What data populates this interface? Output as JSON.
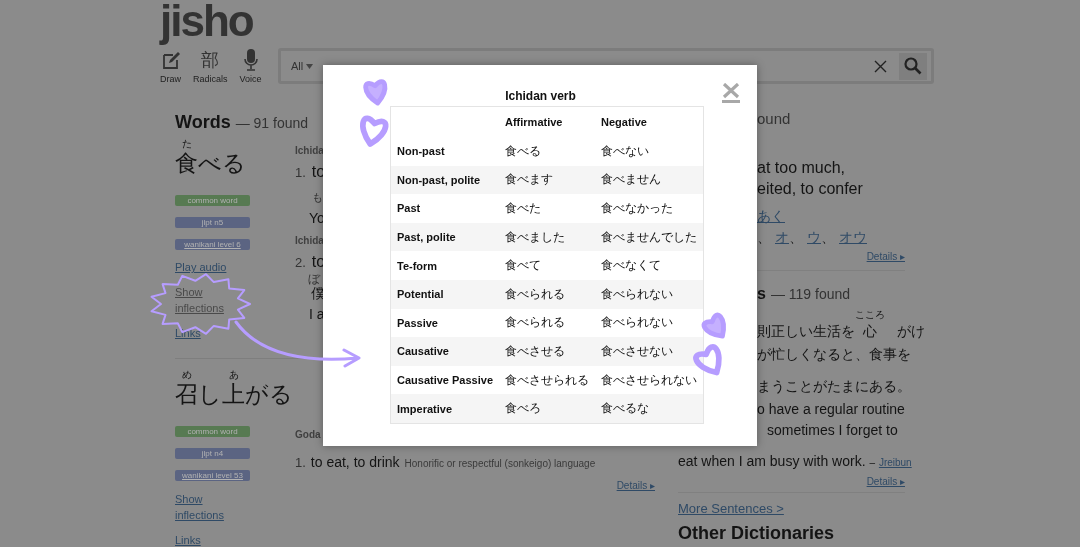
{
  "logo": "jisho",
  "tools": [
    {
      "kind": "draw",
      "label": "Draw"
    },
    {
      "kind": "radicals",
      "glyph": "部",
      "label": "Radicals"
    },
    {
      "kind": "voice",
      "label": "Voice"
    }
  ],
  "search": {
    "filter": "All"
  },
  "words": {
    "heading": "Words",
    "count": "— 91 found",
    "entries": [
      {
        "parts": [
          {
            "text": "食",
            "furigana": "た"
          },
          {
            "text": "べる"
          }
        ],
        "tags": [
          {
            "kind": "common",
            "label": "common word"
          },
          {
            "kind": "jlpt",
            "label": "jlpt n5"
          },
          {
            "kind": "wanikani",
            "label": "wanikani level 6"
          }
        ],
        "links": [
          {
            "kind": "audio",
            "label": "Play audio",
            "selected": false
          },
          {
            "kind": "inflections",
            "label": "Show inflections",
            "selected": true
          },
          {
            "kind": "links",
            "label": "Links",
            "selected": false
          }
        ]
      },
      {
        "parts": [
          {
            "text": "召",
            "furigana": "め"
          },
          {
            "text": "し"
          },
          {
            "text": "上",
            "furigana": "あ"
          },
          {
            "text": "がる"
          }
        ],
        "tags": [
          {
            "kind": "common",
            "label": "common word"
          },
          {
            "kind": "jlpt",
            "label": "jlpt n4"
          },
          {
            "kind": "wanikani",
            "label": "wanikani level 53"
          }
        ],
        "links": [
          {
            "kind": "inflections",
            "label": "Show inflections",
            "selected": false
          },
          {
            "kind": "links",
            "label": "Links",
            "selected": false
          }
        ]
      }
    ]
  },
  "senses_fragments": [
    {
      "kind": "pos",
      "text": "Ichida"
    },
    {
      "kind": "sense",
      "num": "1.",
      "text": "to"
    },
    {
      "kind": "small",
      "text": "も"
    },
    {
      "kind": "line",
      "text": "Yo"
    },
    {
      "kind": "pos",
      "text": "Ichida"
    },
    {
      "kind": "sense",
      "num": "2.",
      "text": "to"
    },
    {
      "kind": "ruby",
      "text": "ぼ"
    },
    {
      "kind": "jp",
      "text": "僕"
    },
    {
      "kind": "line",
      "text": "I a"
    },
    {
      "kind": "pos",
      "text": "Goda"
    }
  ],
  "second_sense": {
    "num": "1.",
    "text": "to eat, to drink",
    "note": "Honorific or respectful (sonkeigo) language",
    "details": "Details ▸"
  },
  "kanji_fragments": {
    "count": "ound",
    "lines": [
      "at too much,",
      "eited, to confer"
    ],
    "reading_link": "あく",
    "readings": [
      "オ",
      "ウ",
      "オウ"
    ],
    "separator": "、",
    "details": "Details ▸"
  },
  "sentences": {
    "heading_tail": "s",
    "count": "— 119 found",
    "line_1": "則正しい生活を",
    "ruby_base": "心",
    "ruby_text": "こころ",
    "line_1_end": "がけ",
    "line_2": "が忙しくなると、食事を",
    "line_3": "まうことがたまにある。",
    "en_1": "o have a regular routine",
    "en_2": "sometimes I forget to",
    "en_3": "eat when I am busy with work.",
    "source": "Jreibun",
    "source_dash": "–",
    "details": "Details ▸",
    "more": "More Sentences >"
  },
  "other_heading": "Other Dictionaries",
  "modal": {
    "title": "Ichidan verb",
    "columns": [
      "Affirmative",
      "Negative"
    ],
    "rows": [
      {
        "form": "Non-past",
        "affirmative": "食べる",
        "negative": "食べない"
      },
      {
        "form": "Non-past, polite",
        "affirmative": "食べます",
        "negative": "食べません"
      },
      {
        "form": "Past",
        "affirmative": "食べた",
        "negative": "食べなかった"
      },
      {
        "form": "Past, polite",
        "affirmative": "食べました",
        "negative": "食べませんでした"
      },
      {
        "form": "Te-form",
        "affirmative": "食べて",
        "negative": "食べなくて"
      },
      {
        "form": "Potential",
        "affirmative": "食べられる",
        "negative": "食べられない"
      },
      {
        "form": "Passive",
        "affirmative": "食べられる",
        "negative": "食べられない"
      },
      {
        "form": "Causative",
        "affirmative": "食べさせる",
        "negative": "食べさせない"
      },
      {
        "form": "Causative Passive",
        "affirmative": "食べさせられる",
        "negative": "食べさせられない"
      },
      {
        "form": "Imperative",
        "affirmative": "食べろ",
        "negative": "食べるな"
      }
    ]
  }
}
